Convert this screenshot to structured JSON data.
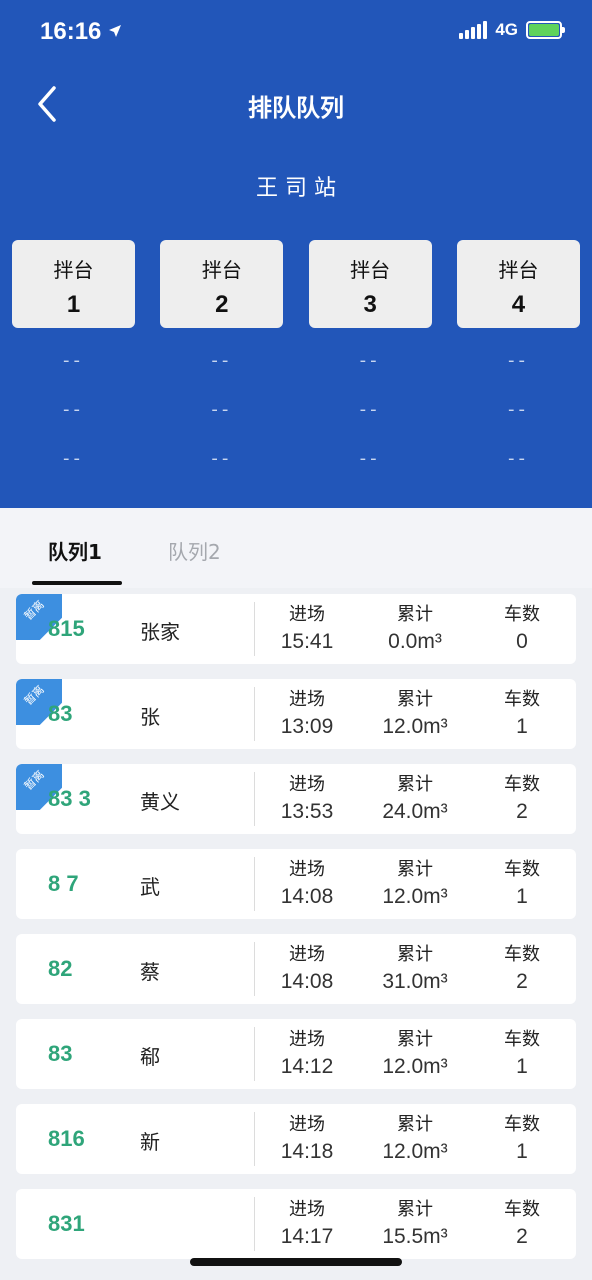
{
  "status": {
    "time": "16:16",
    "network": "4G"
  },
  "header": {
    "title": "排队队列",
    "station": "王  司  站"
  },
  "bays": [
    {
      "label": "拌台",
      "number": "1"
    },
    {
      "label": "拌台",
      "number": "2"
    },
    {
      "label": "拌台",
      "number": "3"
    },
    {
      "label": "拌台",
      "number": "4"
    }
  ],
  "slot_placeholder": "--",
  "tabs": [
    {
      "label": "队列1"
    },
    {
      "label": "队列2"
    }
  ],
  "columns": {
    "entry": "进场",
    "total": "累计",
    "count": "车数"
  },
  "tag_label": "暂离",
  "rows": [
    {
      "plate": "815",
      "driver": "张家",
      "entry_time": "15:41",
      "total": "0.0m³",
      "count": "0",
      "tag": true
    },
    {
      "plate": "83",
      "driver": "张",
      "entry_time": "13:09",
      "total": "12.0m³",
      "count": "1",
      "tag": true
    },
    {
      "plate": "83 3",
      "driver": "黄义",
      "entry_time": "13:53",
      "total": "24.0m³",
      "count": "2",
      "tag": true
    },
    {
      "plate": "8 7",
      "driver": "武",
      "entry_time": "14:08",
      "total": "12.0m³",
      "count": "1",
      "tag": false
    },
    {
      "plate": "82",
      "driver": "蔡",
      "entry_time": "14:08",
      "total": "31.0m³",
      "count": "2",
      "tag": false
    },
    {
      "plate": "83",
      "driver": "郗",
      "entry_time": "14:12",
      "total": "12.0m³",
      "count": "1",
      "tag": false
    },
    {
      "plate": "816",
      "driver": "新",
      "entry_time": "14:18",
      "total": "12.0m³",
      "count": "1",
      "tag": false
    },
    {
      "plate": "831",
      "driver": "",
      "entry_time": "14:17",
      "total": "15.5m³",
      "count": "2",
      "tag": false
    }
  ],
  "colors": {
    "header_bg": "#2256b9",
    "plate": "#2fa57a",
    "tag": "#3d8fe0"
  },
  "icons": {
    "back": "chevron-left-icon",
    "signal": "signal-icon",
    "battery": "battery-charging-icon",
    "location": "location-arrow-icon"
  }
}
